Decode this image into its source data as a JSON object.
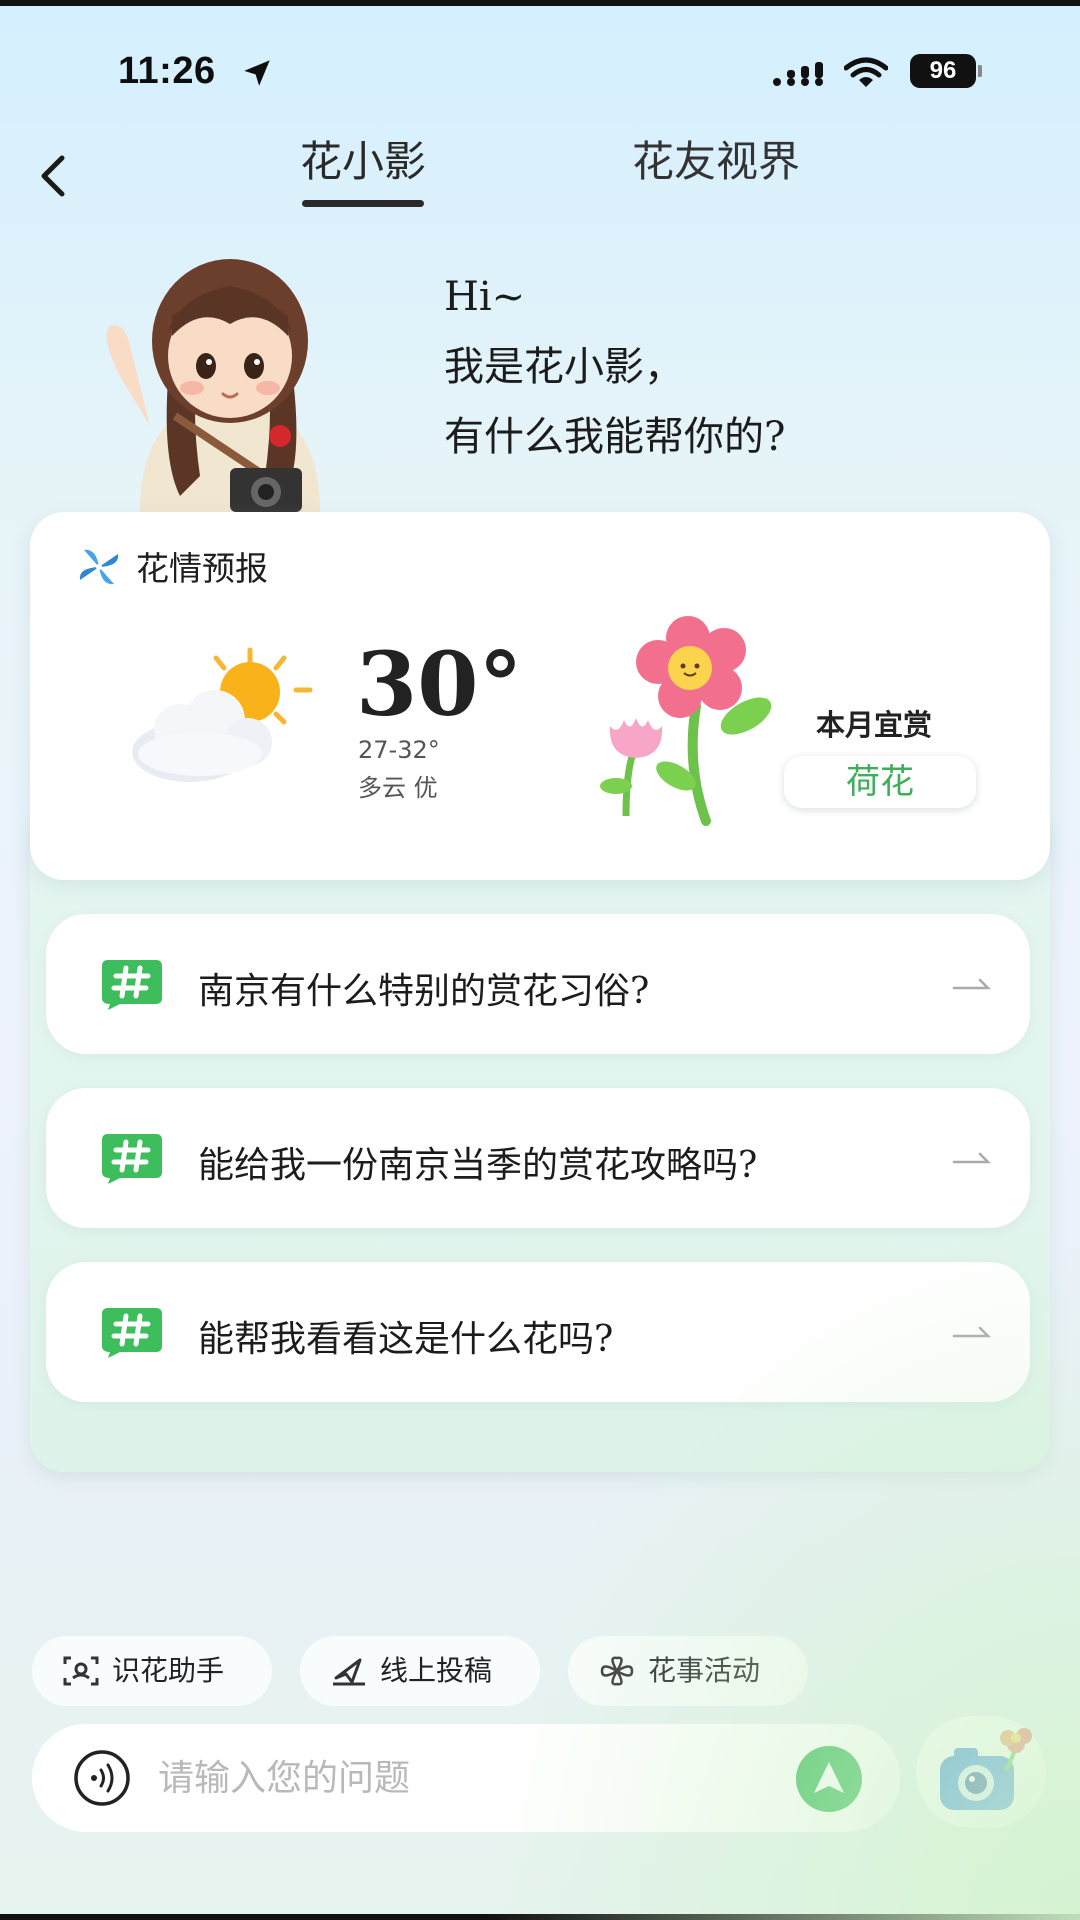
{
  "status_bar": {
    "time": "11:26",
    "battery": "96"
  },
  "nav": {
    "tabs": [
      {
        "label": "花小影",
        "active": true
      },
      {
        "label": "花友视界",
        "active": false
      }
    ]
  },
  "greeting": {
    "line1": "Hi~",
    "line2": "我是花小影，",
    "line3": "有什么我能帮你的?"
  },
  "forecast": {
    "title": "花情预报",
    "temperature": "30°",
    "range": "27-32°",
    "condition": "多云 优",
    "month_label": "本月宜赏",
    "flower": "荷花"
  },
  "questions": [
    {
      "text": "南京有什么特别的赏花习俗?"
    },
    {
      "text": "能给我一份南京当季的赏花攻略吗?"
    },
    {
      "text": "能帮我看看这是什么花吗?"
    }
  ],
  "chips": [
    {
      "label": "识花助手",
      "icon": "scan-flower-icon"
    },
    {
      "label": "线上投稿",
      "icon": "paper-plane-icon"
    },
    {
      "label": "花事活动",
      "icon": "flower-outline-icon"
    }
  ],
  "input": {
    "placeholder": "请输入您的问题"
  },
  "colors": {
    "accent_green": "#3dbd5c",
    "flower_text": "#3fae5b"
  }
}
